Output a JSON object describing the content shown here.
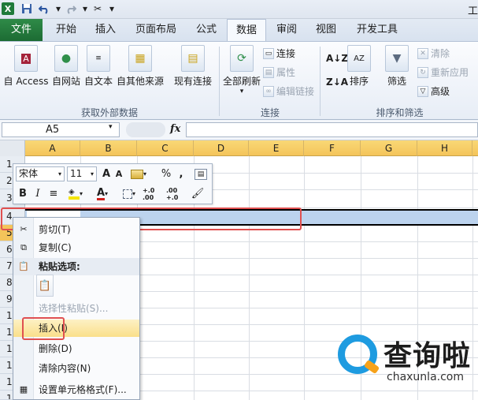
{
  "qat": {
    "app_icon": "X",
    "save_icon": "save-icon",
    "undo_icon": "undo-icon",
    "redo_icon": "redo-icon",
    "title_fragment": "工"
  },
  "tabs": [
    {
      "label": "文件"
    },
    {
      "label": "开始"
    },
    {
      "label": "插入"
    },
    {
      "label": "页面布局"
    },
    {
      "label": "公式"
    },
    {
      "label": "数据"
    },
    {
      "label": "审阅"
    },
    {
      "label": "视图"
    },
    {
      "label": "开发工具"
    }
  ],
  "ribbon": {
    "external": {
      "access": "自 Access",
      "web": "自网站",
      "text": "自文本",
      "other": "自其他来源",
      "existing": "现有连接",
      "group_label": "获取外部数据"
    },
    "connections": {
      "refresh_all": "全部刷新",
      "connections": "连接",
      "properties": "属性",
      "edit_links": "编辑链接",
      "group_label": "连接"
    },
    "sort_filter": {
      "sort": "排序",
      "filter": "筛选",
      "clear": "清除",
      "reapply": "重新应用",
      "advanced": "高级",
      "group_label": "排序和筛选"
    }
  },
  "formula_bar": {
    "name_box": "A5",
    "fx": "fx"
  },
  "columns": [
    "A",
    "B",
    "C",
    "D",
    "E",
    "F",
    "G",
    "H"
  ],
  "rows": [
    "1",
    "2",
    "3",
    "4",
    "5",
    "6",
    "7",
    "8",
    "9",
    "10",
    "11",
    "12",
    "13",
    "14",
    "15"
  ],
  "mini_toolbar": {
    "font": "宋体",
    "size": "11",
    "grow": "A",
    "shrink": "A",
    "percent": "%",
    "comma": ",",
    "bold": "B",
    "italic": "I",
    "font_color": "A",
    "dec_inc": "+.0 .00",
    "dec_dec": ".00 +.0"
  },
  "context_menu": {
    "cut": "剪切(T)",
    "copy": "复制(C)",
    "paste_options": "粘贴选项:",
    "paste_special": "选择性粘贴(S)...",
    "insert": "插入(I)",
    "delete": "删除(D)",
    "clear_contents": "清除内容(N)",
    "format_cells": "设置单元格格式(F)..."
  },
  "watermark": {
    "text": "查询啦",
    "url": "chaxunla.com"
  },
  "colors": {
    "file_tab": "#1f7a3a",
    "selection_row": "#bcd3ee",
    "highlight_box": "#e05050",
    "column_header": "#f4c45a",
    "watermark_blue": "#1e9be0",
    "watermark_orange": "#f6a21b"
  }
}
